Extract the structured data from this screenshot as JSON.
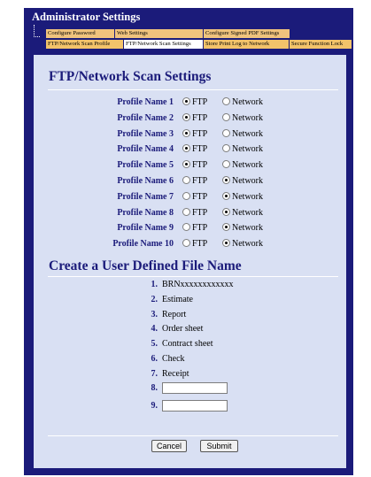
{
  "app_title": "Administrator Settings",
  "tabs_row1": [
    "Configure Password",
    "Web Settings",
    "Configure Signed PDF Settings"
  ],
  "tabs_row2": [
    "FTP/Network Scan Profile",
    "FTP/Network Scan Settings",
    "Store Print Log to Network",
    "Secure Function Lock"
  ],
  "section1_title": "FTP/Network Scan Settings",
  "option_ftp": "FTP",
  "option_network": "Network",
  "profiles": [
    {
      "name": "Profile Name 1",
      "selected": "FTP"
    },
    {
      "name": "Profile Name 2",
      "selected": "FTP"
    },
    {
      "name": "Profile Name 3",
      "selected": "FTP"
    },
    {
      "name": "Profile Name 4",
      "selected": "FTP"
    },
    {
      "name": "Profile Name 5",
      "selected": "FTP"
    },
    {
      "name": "Profile Name 6",
      "selected": "Network"
    },
    {
      "name": "Profile Name 7",
      "selected": "Network"
    },
    {
      "name": "Profile Name 8",
      "selected": "Network"
    },
    {
      "name": "Profile Name 9",
      "selected": "Network"
    },
    {
      "name": "Profile Name 10",
      "selected": "Network"
    }
  ],
  "section2_title": "Create a User Defined File Name",
  "file_names": [
    {
      "num": "1.",
      "value": "BRNxxxxxxxxxxxx"
    },
    {
      "num": "2.",
      "value": "Estimate"
    },
    {
      "num": "3.",
      "value": "Report"
    },
    {
      "num": "4.",
      "value": "Order sheet"
    },
    {
      "num": "5.",
      "value": "Contract sheet"
    },
    {
      "num": "6.",
      "value": "Check"
    },
    {
      "num": "7.",
      "value": "Receipt"
    }
  ],
  "file_inputs": [
    {
      "num": "8.",
      "value": ""
    },
    {
      "num": "9.",
      "value": ""
    }
  ],
  "cancel_label": "Cancel",
  "submit_label": "Submit",
  "colors": {
    "frame": "#1b1b7a",
    "panel": "#d9e0f3",
    "tab": "#f0c37d"
  }
}
